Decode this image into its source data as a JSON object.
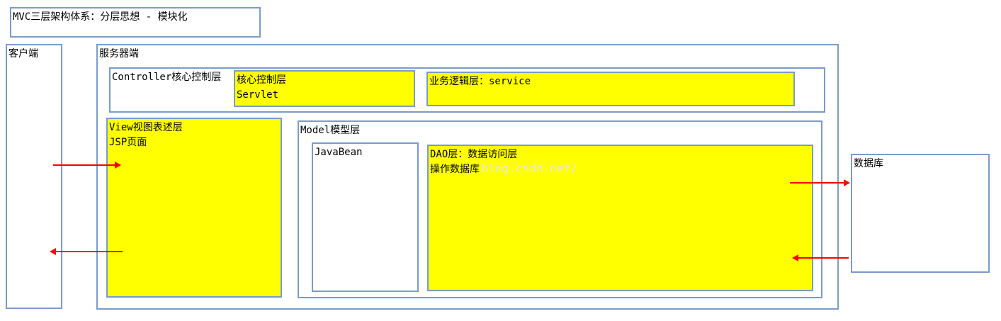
{
  "title": "MVC三层架构体系：分层思想 - 模块化",
  "client": {
    "label": "客户端"
  },
  "server": {
    "label": "服务器端",
    "controller": {
      "label": "Controller核心控制层",
      "core": {
        "line1": "核心控制层",
        "line2": "Servlet"
      },
      "service": {
        "label": "业务逻辑层：service"
      }
    },
    "view": {
      "line1": "View视图表述层",
      "line2": "JSP页面"
    },
    "model": {
      "label": "Model模型层",
      "javabean": {
        "label": "JavaBean"
      },
      "dao": {
        "line1": "DAO层：数据访问层",
        "line2": "操作数据库"
      }
    }
  },
  "database": {
    "label": "数据库"
  },
  "watermark": "blog.csdn.net/",
  "colors": {
    "border": "#7a9cc9",
    "fill": "#ffff00",
    "arrow": "#ff0000"
  }
}
